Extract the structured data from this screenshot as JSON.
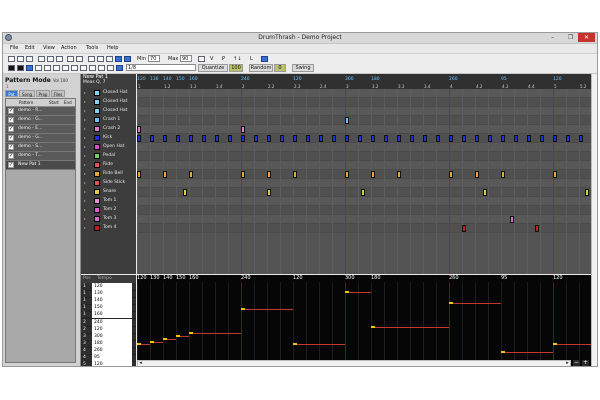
{
  "window": {
    "title": "DrumThrash - Demo Project",
    "app_icon": "drum-app-icon"
  },
  "window_controls": {
    "minimize": "–",
    "maximize": "❐",
    "close": "✕"
  },
  "menu": [
    "File",
    "Edit",
    "View",
    "Action",
    "Tools",
    "Help"
  ],
  "toolbar": {
    "min_label": "Min",
    "min_value": "70",
    "max_label": "Max",
    "max_value": "90",
    "icon_letters": [
      "V",
      "P",
      "↑↓",
      "L"
    ],
    "grid_value": "1/8",
    "quantize_label": "Quantize",
    "quantize_value": "100",
    "random_label": "Random",
    "random_value": "0",
    "swing_label": "Swing"
  },
  "left_panel": {
    "mode_title": "Pattern Mode",
    "vol_label": "Vol 100",
    "mode_marker": "1",
    "tabs": [
      "Pat",
      "Song",
      "Prop",
      "Files"
    ],
    "columns": [
      "Pattern",
      "Start",
      "End"
    ],
    "patterns": [
      "demo - R...",
      "demo - G...",
      "demo - E...",
      "demo - G...",
      "demo - S...",
      "demo - T...",
      "New Pat 1"
    ]
  },
  "pattern_header": {
    "name": "New Pat 1",
    "measure_label": "Meas Q, 7"
  },
  "instruments": [
    {
      "name": "Closed Hat",
      "color": "#7fd3ff"
    },
    {
      "name": "Closed Hat",
      "color": "#7fd3ff"
    },
    {
      "name": "Closed Hat",
      "color": "#7fd3ff"
    },
    {
      "name": "Crash 1",
      "color": "#6fc4ff"
    },
    {
      "name": "Crash 2",
      "color": "#e07bd0"
    },
    {
      "name": "Kick",
      "color": "#2033d6"
    },
    {
      "name": "Open Hat",
      "color": "#d64bd0"
    },
    {
      "name": "Pedal",
      "color": "#6ed068"
    },
    {
      "name": "Ride",
      "color": "#e35252"
    },
    {
      "name": "Ride Bell",
      "color": "#f2a13a"
    },
    {
      "name": "Side Stick",
      "color": "#e35252"
    },
    {
      "name": "Snare",
      "color": "#d8d040"
    },
    {
      "name": "Tom 1",
      "color": "#f08ce0"
    },
    {
      "name": "Tom 2",
      "color": "#e35bd0"
    },
    {
      "name": "Tom 3",
      "color": "#d66bd0"
    },
    {
      "name": "Tom 4",
      "color": "#c02020"
    }
  ],
  "ruler": {
    "tempo_labels": [
      "120",
      "130",
      "140",
      "150",
      "160",
      "240",
      "120",
      "300",
      "180",
      "260",
      "95",
      "120"
    ],
    "beat_labels": [
      "1",
      "1.2",
      "1.3",
      "1.4",
      "2",
      "2.2",
      "2.3",
      "2.4",
      "3",
      "3.2",
      "3.3",
      "3.4",
      "4",
      "4.2",
      "4.3",
      "4.4",
      "5",
      "5.2"
    ]
  },
  "tempo_lane": {
    "labels": [
      "120",
      "130",
      "140",
      "150",
      "160",
      "240",
      "120",
      "300",
      "180",
      "260",
      "95",
      "120"
    ]
  },
  "tempo_table": {
    "columns": [
      "Pos",
      "Tempo"
    ],
    "rows": [
      {
        "pos": "1",
        "tempo": "120"
      },
      {
        "pos": "1",
        "tempo": "130"
      },
      {
        "pos": "1",
        "tempo": "140"
      },
      {
        "pos": "1",
        "tempo": "150"
      },
      {
        "pos": "1",
        "tempo": "160"
      },
      {
        "pos": "2",
        "tempo": "240"
      },
      {
        "pos": "2",
        "tempo": "120"
      },
      {
        "pos": "3",
        "tempo": "300"
      },
      {
        "pos": "3",
        "tempo": "180"
      },
      {
        "pos": "4",
        "tempo": "260"
      },
      {
        "pos": "4",
        "tempo": "95"
      },
      {
        "pos": "5",
        "tempo": "120"
      }
    ]
  },
  "scroll": {
    "minus": "−",
    "plus": "+"
  }
}
